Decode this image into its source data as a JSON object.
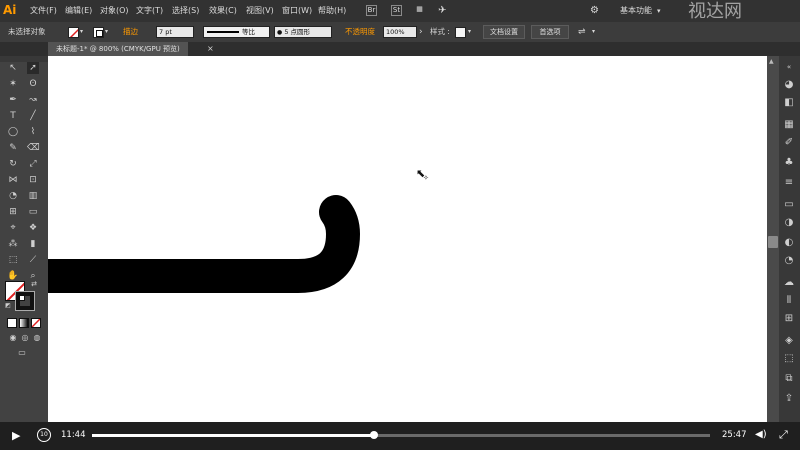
{
  "app": {
    "logo": "Ai",
    "menus": [
      "文件(F)",
      "编辑(E)",
      "对象(O)",
      "文字(T)",
      "选择(S)",
      "效果(C)",
      "视图(V)",
      "窗口(W)",
      "帮助(H)"
    ],
    "workspace": "基本功能",
    "br_icon": "Br",
    "st_icon": "St"
  },
  "control": {
    "selection": "未选择对象",
    "stroke_label": "描边",
    "stroke_value": "7 pt",
    "profile": "等比",
    "brush": "5 点圆形",
    "opacity_label": "不透明度",
    "opacity_value": "100%",
    "style_label": "样式 :",
    "doc_setup": "文档设置",
    "preferences": "首选项"
  },
  "tab": {
    "title": "未标题-1* @ 800% (CMYK/GPU 预览)",
    "close": "×"
  },
  "video": {
    "current_time": "11:44",
    "total_time": "25:47",
    "progress": 0.457,
    "replay_label": "10"
  },
  "watermark": "视达网",
  "colors": {
    "accent": "#ff9a00",
    "canvas": "#ffffff",
    "path": "#000000"
  },
  "icons": {
    "play": "play-icon",
    "replay": "replay-10-icon",
    "volume": "volume-icon",
    "fullscreen": "fullscreen-icon"
  }
}
